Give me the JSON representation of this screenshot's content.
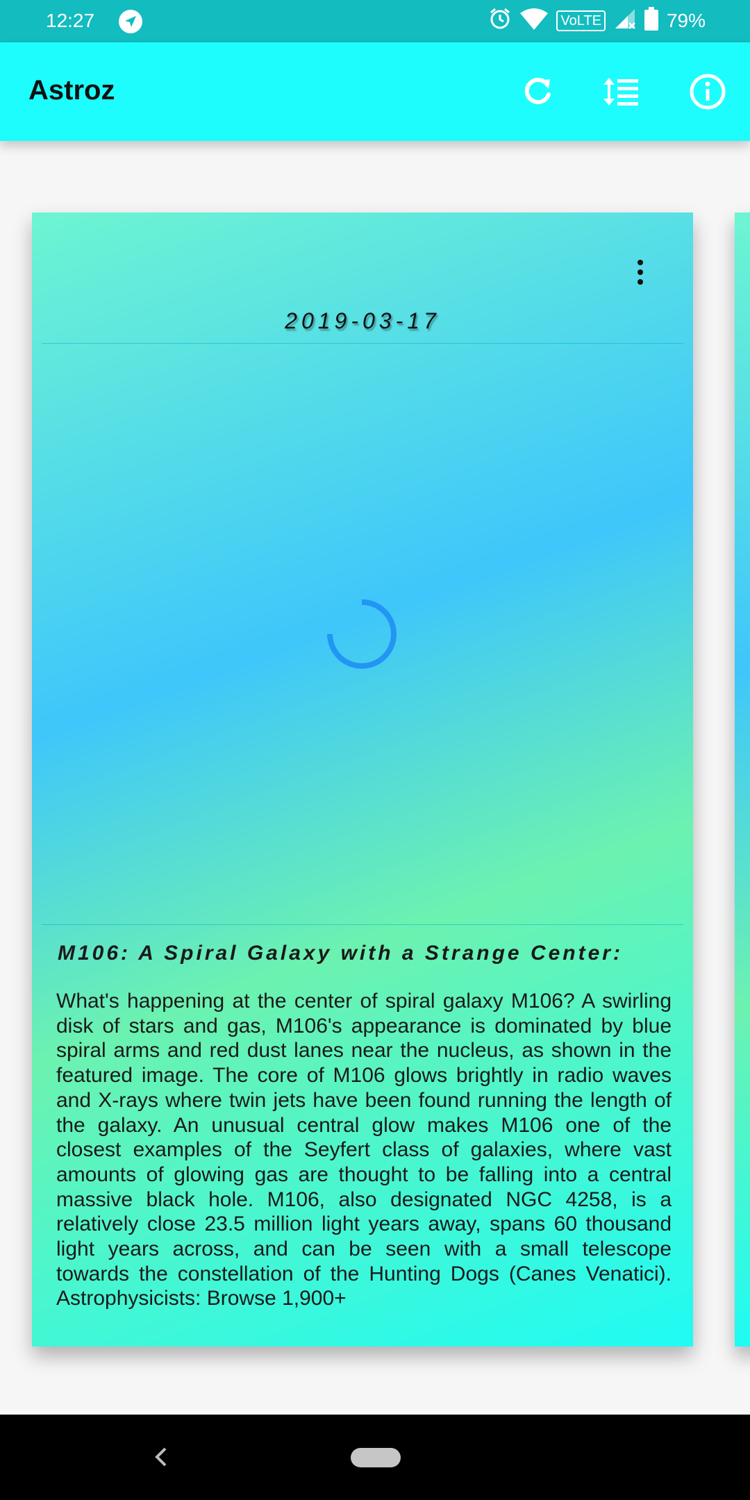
{
  "status_bar": {
    "time": "12:27",
    "volte": "VoLTE",
    "battery": "79%"
  },
  "app_bar": {
    "title": "Astroz",
    "actions": [
      "refresh-icon",
      "sort-icon",
      "info-icon"
    ]
  },
  "card": {
    "date": "2019-03-17",
    "title": "M106: A Spiral Galaxy with a Strange Center:",
    "body": "What's happening at the center of spiral galaxy M106? A swirling disk of stars and gas, M106's appearance is dominated by blue spiral arms and red  dust lanes near the nucleus, as shown in the featured image.  The core of M106 glows brightly in radio waves and X-rays where twin jets have been found running the length of the galaxy.  An unusual central glow makes M106 one of the closest examples of the Seyfert class of galaxies, where vast amounts of glowing gas are thought to be falling into a central massive black hole.  M106, also designated NGC 4258, is a relatively close 23.5 million light years away, spans 60 thousand light years across, and can be seen with a small telescope towards the constellation of the Hunting Dogs (Canes Venatici).      Astrophysicists: Browse 1,900+"
  },
  "colors": {
    "status_bar": "#12bcbf",
    "app_bar": "#1dfdfd",
    "spinner": "#2196f3"
  }
}
